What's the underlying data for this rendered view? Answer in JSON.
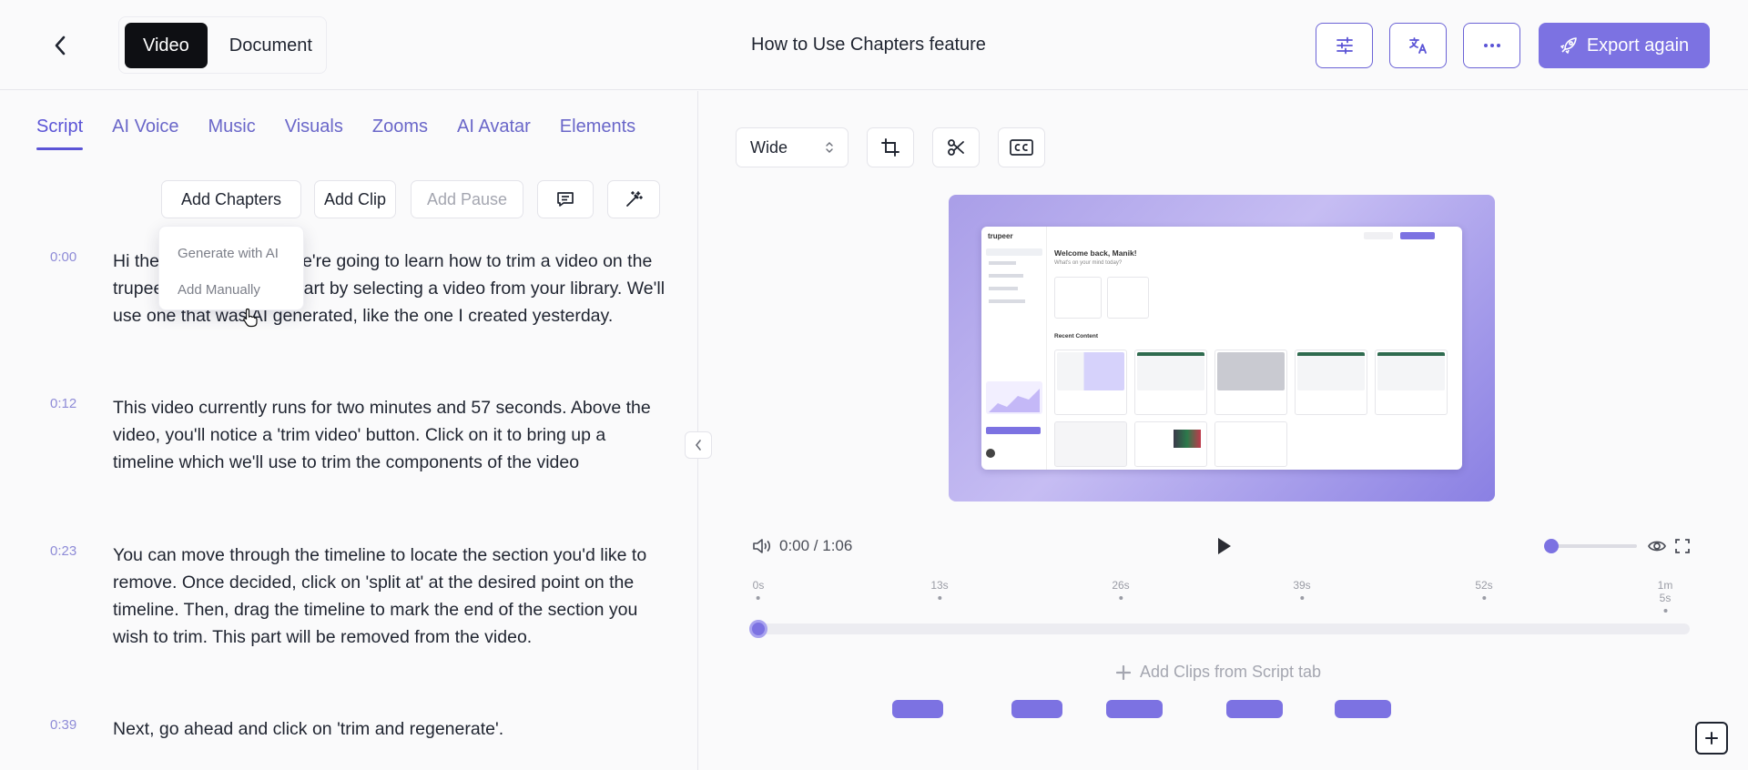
{
  "header": {
    "modes": [
      "Video",
      "Document"
    ],
    "title": "How to Use Chapters feature",
    "export_label": "Export again"
  },
  "tabs": [
    "Script",
    "AI Voice",
    "Music",
    "Visuals",
    "Zooms",
    "AI Avatar",
    "Elements"
  ],
  "toolbar": {
    "add_chapters": "Add Chapters",
    "add_clip": "Add Clip",
    "add_pause": "Add Pause"
  },
  "chapters_menu": [
    "Generate with AI",
    "Add Manually"
  ],
  "script": [
    {
      "time": "0:00",
      "text": "Hi there! In this video, we're going to learn how to trim a video on the trupeer platform. Let's start by selecting a video from your library. We'll use one that was AI generated, like the one I created yesterday."
    },
    {
      "time": "0:12",
      "text": "This video currently runs for two minutes and 57 seconds. Above the video, you'll notice a 'trim video' button. Click on it to bring up a timeline which we'll use to trim the components of the video"
    },
    {
      "time": "0:23",
      "text": "You can move through the timeline to locate the section you'd like to remove. Once decided, click on 'split at' at the desired point on the timeline. Then, drag the timeline to mark the end of the section you wish to trim. This part will be removed from the video."
    },
    {
      "time": "0:39",
      "text": "Next, go ahead and click on 'trim and regenerate'."
    }
  ],
  "preview": {
    "aspect": "Wide",
    "app_brand": "trupeer",
    "welcome": "Welcome back, Manik!",
    "subtitle": "What's on your mind today?",
    "recent": "Recent Content"
  },
  "player": {
    "time": "0:00 / 1:06",
    "ticks": [
      "0s",
      "13s",
      "26s",
      "39s",
      "52s",
      "1m 5s"
    ],
    "add_clips": "Add Clips from Script tab"
  },
  "colors": {
    "accent": "#7c72e2",
    "tab_text": "#6a67c9",
    "timestamp": "#8e8bd7"
  }
}
